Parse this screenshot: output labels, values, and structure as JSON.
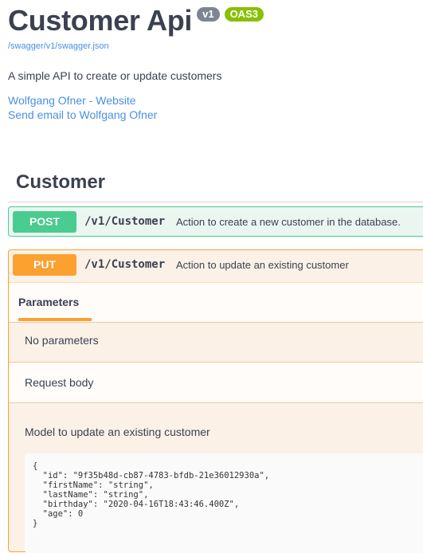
{
  "info": {
    "title": "Customer Api",
    "version_badge": "v1",
    "oas_badge": "OAS3",
    "spec_url": "/swagger/v1/swagger.json",
    "description": "A simple API to create or update customers",
    "contact_website": "Wolfgang Ofner - Website",
    "contact_email": "Send email to Wolfgang Ofner"
  },
  "tag": {
    "name": "Customer"
  },
  "operations": [
    {
      "method": "POST",
      "path": "/v1/Customer",
      "description": "Action to create a new customer in the database.",
      "color": "#49cc90"
    },
    {
      "method": "PUT",
      "path": "/v1/Customer",
      "description": "Action to update an existing customer",
      "color": "#fca130",
      "parameters_tab": "Parameters",
      "no_parameters": "No parameters",
      "request_body_label": "Request body",
      "model_description": "Model to update an existing customer",
      "example": "{\n  \"id\": \"9f35b48d-cb87-4783-bfdb-21e36012930a\",\n  \"firstName\": \"string\",\n  \"lastName\": \"string\",\n  \"birthday\": \"2020-04-16T18:43:46.400Z\",\n  \"age\": 0\n}"
    }
  ]
}
